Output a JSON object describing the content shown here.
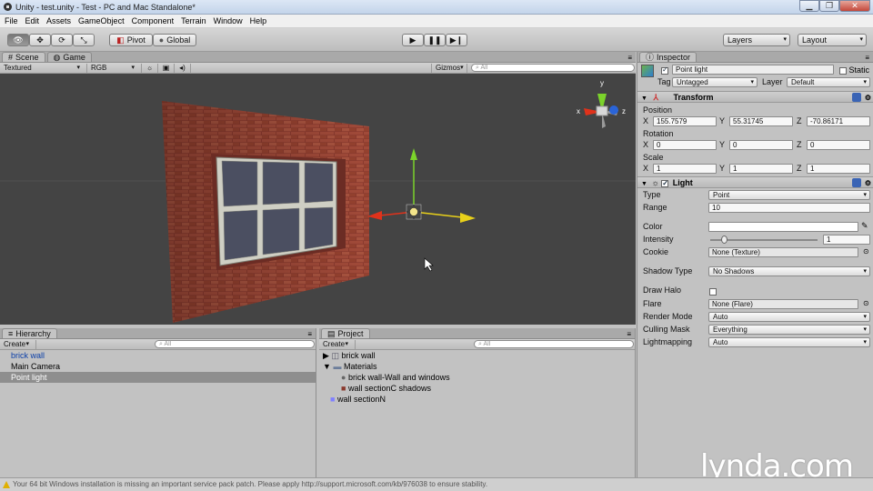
{
  "window": {
    "title": "Unity - test.unity - Test - PC and Mac Standalone*",
    "controls": [
      "minimize",
      "maximize",
      "close"
    ]
  },
  "menu": [
    "File",
    "Edit",
    "Assets",
    "GameObject",
    "Component",
    "Terrain",
    "Window",
    "Help"
  ],
  "toolbar": {
    "pivot_label": "Pivot",
    "global_label": "Global",
    "layers_label": "Layers",
    "layout_label": "Layout"
  },
  "scene": {
    "tabs": [
      "Scene",
      "Game"
    ],
    "render_mode": "Textured",
    "color_mode": "RGB",
    "gizmos_label": "Gizmos",
    "search_placeholder": "All"
  },
  "hierarchy": {
    "tab_label": "Hierarchy",
    "create_label": "Create",
    "search_placeholder": "All",
    "items": [
      "brick wall",
      "Main Camera",
      "Point light"
    ],
    "selected": "Point light"
  },
  "project": {
    "tab_label": "Project",
    "create_label": "Create",
    "search_placeholder": "All",
    "items": [
      "brick wall",
      "Materials",
      "brick wall-Wall and windows",
      "wall sectionC shadows",
      "wall sectionN"
    ]
  },
  "inspector": {
    "tab_label": "Inspector",
    "object_name": "Point light",
    "static_label": "Static",
    "tag_label": "Tag",
    "tag_value": "Untagged",
    "layer_label": "Layer",
    "layer_value": "Default",
    "transform": {
      "title": "Transform",
      "position_label": "Position",
      "position": {
        "x": "155.7579",
        "y": "55.31745",
        "z": "-70.86171"
      },
      "rotation_label": "Rotation",
      "rotation": {
        "x": "0",
        "y": "0",
        "z": "0"
      },
      "scale_label": "Scale",
      "scale": {
        "x": "1",
        "y": "1",
        "z": "1"
      },
      "axis_x": "X",
      "axis_y": "Y",
      "axis_z": "Z"
    },
    "light": {
      "title": "Light",
      "type_label": "Type",
      "type_value": "Point",
      "range_label": "Range",
      "range_value": "10",
      "color_label": "Color",
      "intensity_label": "Intensity",
      "intensity_value": "1",
      "intensity_fraction": 0.125,
      "cookie_label": "Cookie",
      "cookie_value": "None (Texture)",
      "shadow_label": "Shadow Type",
      "shadow_value": "No Shadows",
      "halo_label": "Draw Halo",
      "flare_label": "Flare",
      "flare_value": "None (Flare)",
      "render_label": "Render Mode",
      "render_value": "Auto",
      "culling_label": "Culling Mask",
      "culling_value": "Everything",
      "lightmapping_label": "Lightmapping",
      "lightmapping_value": "Auto"
    }
  },
  "status": {
    "message": "Your 64 bit Windows installation is missing an important service pack patch. Please apply http://support.microsoft.com/kb/976038 to ensure stability."
  },
  "watermark": "lynda.com",
  "gizmo": {
    "axis_x": "x",
    "axis_y": "y",
    "axis_z": "z"
  },
  "colors": {
    "panel_bg": "#c2c2c2",
    "scene_bg": "#444444",
    "selection": "#8e8e8e",
    "axis_x": "#e0321b",
    "axis_y": "#7bd32b",
    "axis_z": "#e8d01a",
    "brick": "#8a3a2e"
  }
}
